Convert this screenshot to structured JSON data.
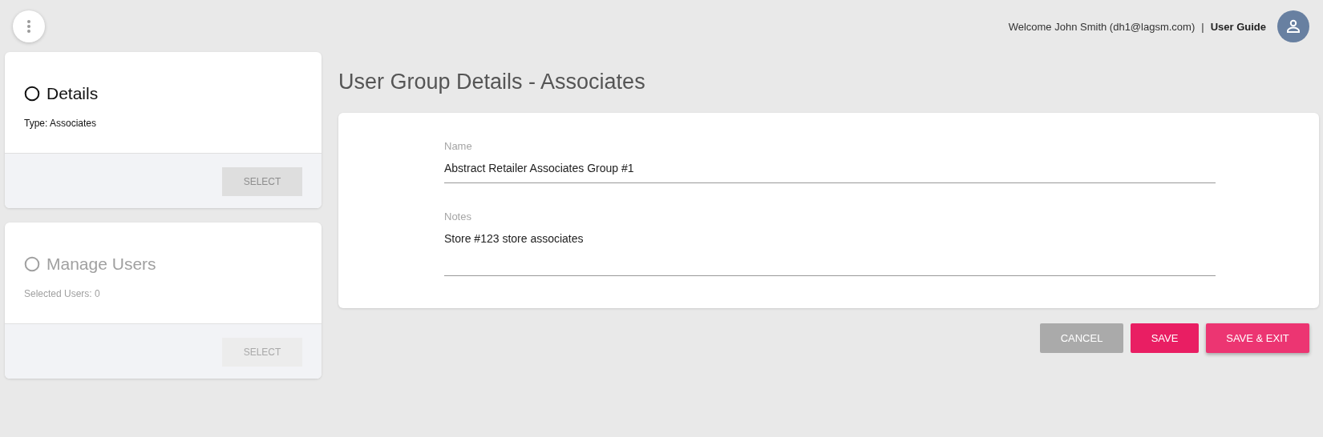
{
  "header": {
    "welcome": "Welcome John Smith (dh1@lagsm.com)",
    "separator": "|",
    "link": "User Guide"
  },
  "steps": [
    {
      "title": "Details",
      "subtitle": "Type: Associates",
      "disabled": false,
      "button": "SELECT"
    },
    {
      "title": "Manage Users",
      "subtitle": "Selected Users: 0",
      "disabled": true,
      "button": "SELECT"
    }
  ],
  "page_title": "User Group Details - Associates",
  "fields": [
    {
      "label": "Name",
      "value": "Abstract Retailer Associates Group #1",
      "kind": "input"
    },
    {
      "label": "Notes",
      "value": "Store #123 store associates",
      "kind": "textarea"
    }
  ],
  "buttons": [
    {
      "label": "CANCEL",
      "kind": "cancel"
    },
    {
      "label": "SAVE",
      "kind": "primary"
    },
    {
      "label": "SAVE & EXIT",
      "kind": "accent"
    }
  ]
}
